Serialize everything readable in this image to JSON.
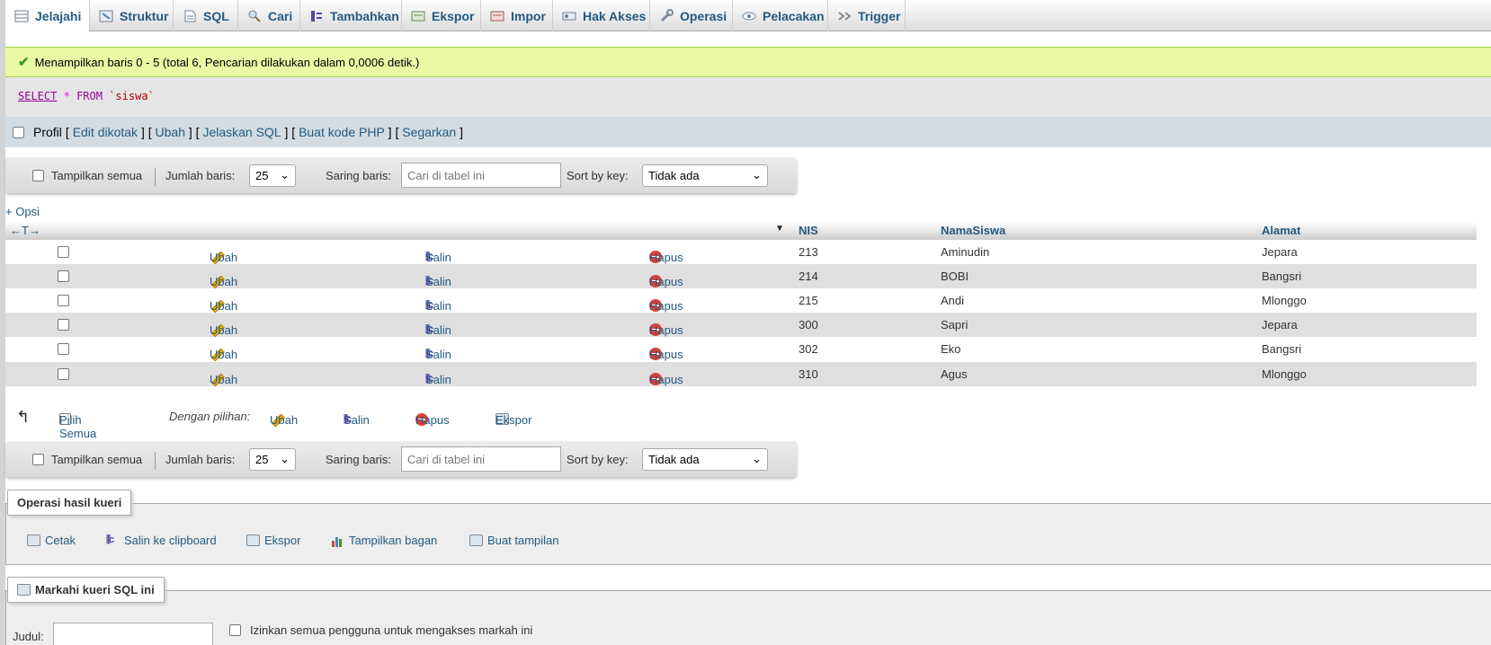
{
  "tabs": [
    {
      "label": "Jelajahi",
      "icon": "browse-icon",
      "active": true
    },
    {
      "label": "Struktur",
      "icon": "structure-icon"
    },
    {
      "label": "SQL",
      "icon": "sql-icon"
    },
    {
      "label": "Cari",
      "icon": "search-icon"
    },
    {
      "label": "Tambahkan",
      "icon": "insert-icon"
    },
    {
      "label": "Ekspor",
      "icon": "export-icon"
    },
    {
      "label": "Impor",
      "icon": "import-icon"
    },
    {
      "label": "Hak Akses",
      "icon": "privileges-icon"
    },
    {
      "label": "Operasi",
      "icon": "wrench-icon"
    },
    {
      "label": "Pelacakan",
      "icon": "eye-icon"
    },
    {
      "label": "Trigger",
      "icon": "trigger-icon"
    }
  ],
  "message": "Menampilkan baris 0 - 5 (total 6, Pencarian dilakukan dalam 0,0006 detik.)",
  "sql": {
    "select": "SELECT",
    "star": "*",
    "from": "FROM",
    "table": "`siswa`"
  },
  "profil": {
    "label": "Profil",
    "edit_inline": "Edit dikotak",
    "edit": "Ubah",
    "explain": "Jelaskan SQL",
    "php": "Buat kode PHP",
    "refresh": "Segarkan"
  },
  "nav": {
    "show_all": "Tampilkan semua",
    "rows_label": "Jumlah baris:",
    "rows_value": "25",
    "filter_label": "Saring baris:",
    "filter_placeholder": "Cari di tabel ini",
    "sort_label": "Sort by key:",
    "sort_value": "Tidak ada"
  },
  "opsi": "+ Opsi",
  "arrows": "←T→",
  "columns": [
    "NIS",
    "NamaSiswa",
    "Alamat"
  ],
  "actions": {
    "edit": "Ubah",
    "copy": "Salin",
    "delete": "Hapus"
  },
  "rows": [
    {
      "nis": "213",
      "nama": "Aminudin",
      "alamat": "Jepara"
    },
    {
      "nis": "214",
      "nama": "BOBI",
      "alamat": "Bangsri"
    },
    {
      "nis": "215",
      "nama": "Andi",
      "alamat": "Mlonggo"
    },
    {
      "nis": "300",
      "nama": "Sapri",
      "alamat": "Jepara"
    },
    {
      "nis": "302",
      "nama": "Eko",
      "alamat": "Bangsri"
    },
    {
      "nis": "310",
      "nama": "Agus",
      "alamat": "Mlonggo"
    }
  ],
  "bulk": {
    "select_all": "Pilih Semua",
    "with_selected": "Dengan pilihan:",
    "edit": "Ubah",
    "copy": "Salin",
    "delete": "Hapus",
    "export": "Ekspor"
  },
  "query_ops": {
    "legend": "Operasi hasil kueri",
    "print": "Cetak",
    "clipboard": "Salin ke clipboard",
    "export": "Ekspor",
    "chart": "Tampilkan bagan",
    "view": "Buat tampilan"
  },
  "bookmark": {
    "legend": "Markahi kueri SQL ini",
    "title_label": "Judul:",
    "shared_label": "Izinkan semua pengguna untuk mengakses markah ini"
  },
  "colors": {
    "link": "#235a81",
    "success_bg": "#ebf8a4",
    "delete": "#d9403a",
    "row_alt": "#dfdfdf"
  }
}
